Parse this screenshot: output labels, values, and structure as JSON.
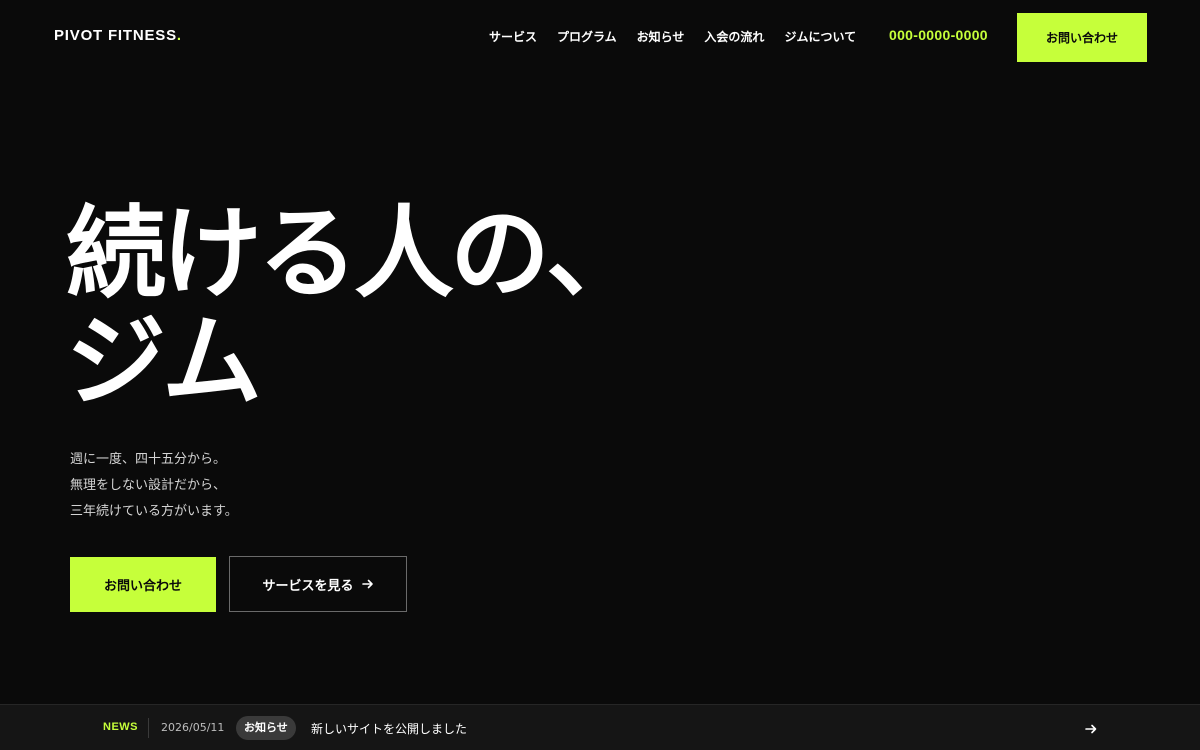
{
  "header": {
    "logo_text": "PIVOT FITNESS",
    "logo_dot": ".",
    "nav": [
      {
        "label": "サービス"
      },
      {
        "label": "プログラム"
      },
      {
        "label": "お知らせ"
      },
      {
        "label": "入会の流れ"
      },
      {
        "label": "ジムについて"
      }
    ],
    "phone": "000-0000-0000",
    "cta_label": "お問い合わせ"
  },
  "hero": {
    "title_lines": [
      "続ける人の、",
      "ジム"
    ],
    "subtitle_lines": [
      "週に一度、四十五分から。",
      "無理をしない設計だから、",
      "三年続けている方がいます。"
    ],
    "primary_cta": "お問い合わせ",
    "secondary_cta": "サービスを見る"
  },
  "news": {
    "label": "NEWS",
    "date": "2026/05/11",
    "category": "お知らせ",
    "text": "新しいサイトを公開しました"
  },
  "colors": {
    "background": "#0a0a0a",
    "accent": "#c6ff3a",
    "newsbar": "#151515"
  },
  "icons": {
    "secondary_cta_icon": "arrow-right-icon",
    "news_icon": "arrow-right-icon"
  }
}
